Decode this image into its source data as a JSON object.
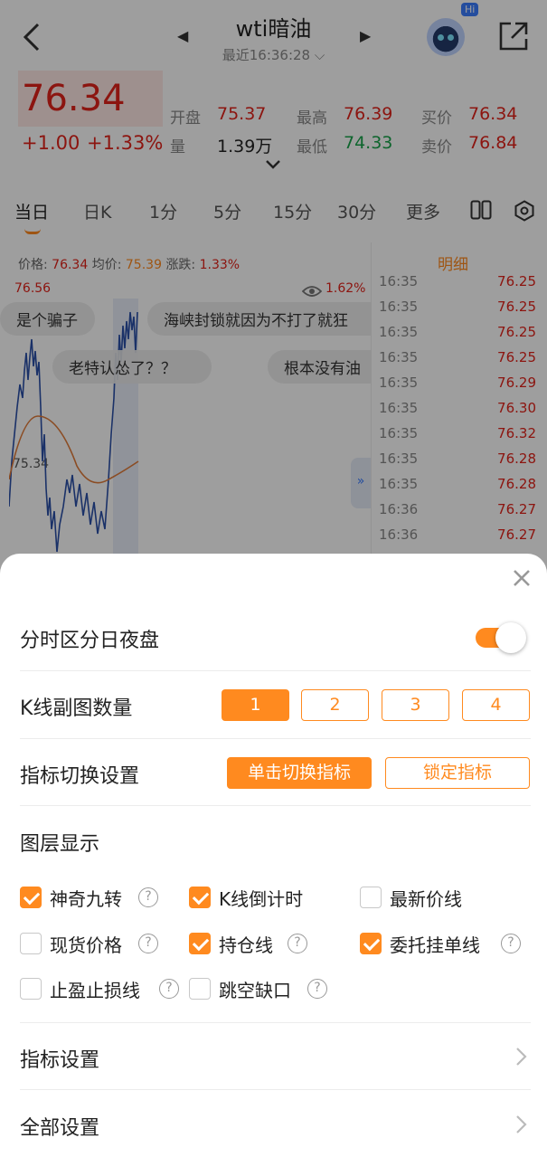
{
  "header": {
    "title": "wti暗油",
    "subtitle": "最近16:36:28 ⌵",
    "hi_badge": "Hi",
    "prev_arrow": "◀",
    "next_arrow": "▶"
  },
  "quote": {
    "last": "76.34",
    "change": "+1.00",
    "change_pct": "+1.33%",
    "items": [
      {
        "label": "开盘",
        "value": "75.37",
        "color": "red"
      },
      {
        "label": "最高",
        "value": "76.39",
        "color": "red"
      },
      {
        "label": "买价",
        "value": "76.34",
        "color": "red"
      },
      {
        "label": "量",
        "value": "1.39万",
        "color": "dark"
      },
      {
        "label": "最低",
        "value": "74.33",
        "color": "green"
      },
      {
        "label": "卖价",
        "value": "76.84",
        "color": "red"
      }
    ]
  },
  "tabs": [
    "当日",
    "日K",
    "1分",
    "5分",
    "15分",
    "30分",
    "更多"
  ],
  "chart": {
    "price_label": "价格:",
    "price_value": "76.34",
    "avg_label": "均价:",
    "avg_value": "75.39",
    "chg_label": "涨跌:",
    "chg_value": "1.33%",
    "high_label": "76.56",
    "mid_label": "75.34",
    "pct_label": "1.62%"
  },
  "danmu": [
    "是个骗子",
    "海峡封锁就因为不打了就狂",
    "老特认怂了？？",
    "根本没有油"
  ],
  "detail": {
    "title": "明细",
    "rows": [
      {
        "time": "16:35",
        "price": "76.25"
      },
      {
        "time": "16:35",
        "price": "76.25"
      },
      {
        "time": "16:35",
        "price": "76.25"
      },
      {
        "time": "16:35",
        "price": "76.25"
      },
      {
        "time": "16:35",
        "price": "76.29"
      },
      {
        "time": "16:35",
        "price": "76.30"
      },
      {
        "time": "16:35",
        "price": "76.32"
      },
      {
        "time": "16:35",
        "price": "76.28"
      },
      {
        "time": "16:35",
        "price": "76.28"
      },
      {
        "time": "16:36",
        "price": "76.27"
      },
      {
        "time": "16:36",
        "price": "76.27"
      }
    ],
    "collapse": "»"
  },
  "sheet": {
    "session_split_label": "分时区分日夜盘",
    "session_split_on": true,
    "k_sub_count_label": "K线副图数量",
    "k_sub_options": [
      "1",
      "2",
      "3",
      "4"
    ],
    "k_sub_selected": "1",
    "indicator_switch_label": "指标切换设置",
    "indicator_modes": [
      "单击切换指标",
      "锁定指标"
    ],
    "indicator_mode_selected": "单击切换指标",
    "layer_label": "图层显示",
    "layers": [
      {
        "label": "神奇九转",
        "checked": true,
        "help": true
      },
      {
        "label": "K线倒计时",
        "checked": true,
        "help": false
      },
      {
        "label": "最新价线",
        "checked": false,
        "help": false
      },
      {
        "label": "现货价格",
        "checked": false,
        "help": true
      },
      {
        "label": "持仓线",
        "checked": true,
        "help": true
      },
      {
        "label": "委托挂单线",
        "checked": true,
        "help": true
      },
      {
        "label": "止盈止损线",
        "checked": false,
        "help": true
      },
      {
        "label": "跳空缺口",
        "checked": false,
        "help": true
      }
    ],
    "help_glyph": "?",
    "indicator_settings_label": "指标设置",
    "all_settings_label": "全部设置"
  },
  "colors": {
    "accent": "#ff8a1f",
    "up": "#e2231a",
    "down": "#18a34a",
    "line": "#2a4fa8",
    "avg_line": "#e07b39"
  }
}
